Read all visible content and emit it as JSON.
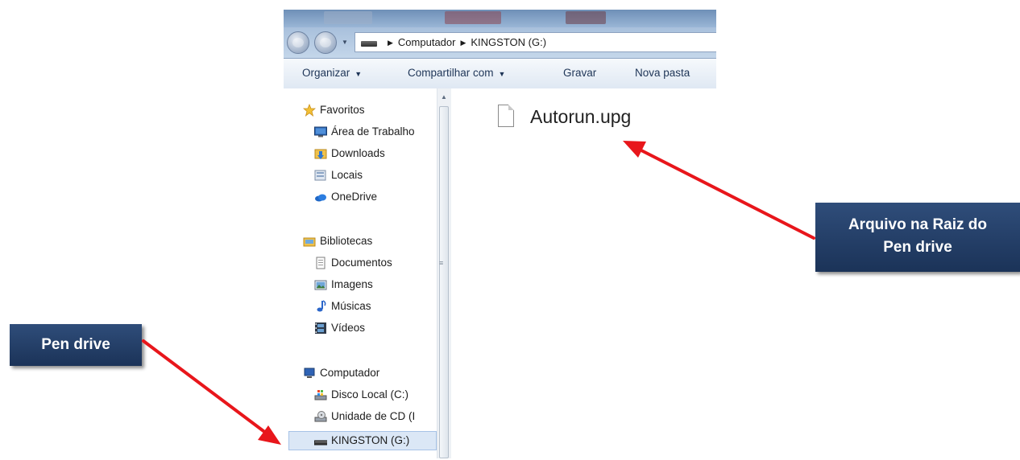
{
  "explorer": {
    "address": {
      "crumbs": [
        "Computador",
        "KINGSTON (G:)"
      ]
    },
    "toolbar": {
      "organize": "Organizar",
      "share": "Compartilhar com",
      "burn": "Gravar",
      "new_folder": "Nova pasta"
    },
    "nav": {
      "favorites": "Favoritos",
      "desktop": "Área de Trabalho",
      "downloads": "Downloads",
      "places": "Locais",
      "onedrive": "OneDrive",
      "libraries": "Bibliotecas",
      "documents": "Documentos",
      "pictures": "Imagens",
      "music": "Músicas",
      "videos": "Vídeos",
      "computer": "Computador",
      "local_disk": "Disco Local (C:)",
      "cd_drive": "Unidade de CD (I",
      "usb_drive": "KINGSTON (G:)"
    },
    "files": [
      {
        "name": "Autorun.upg",
        "icon": "blank-file-icon"
      }
    ]
  },
  "annotations": {
    "pen_drive_label": "Pen drive",
    "root_file_label_line1": "Arquivo na Raiz do",
    "root_file_label_line2": "Pen drive",
    "callout_color": "#23406a",
    "arrow_color": "#e8161b"
  }
}
